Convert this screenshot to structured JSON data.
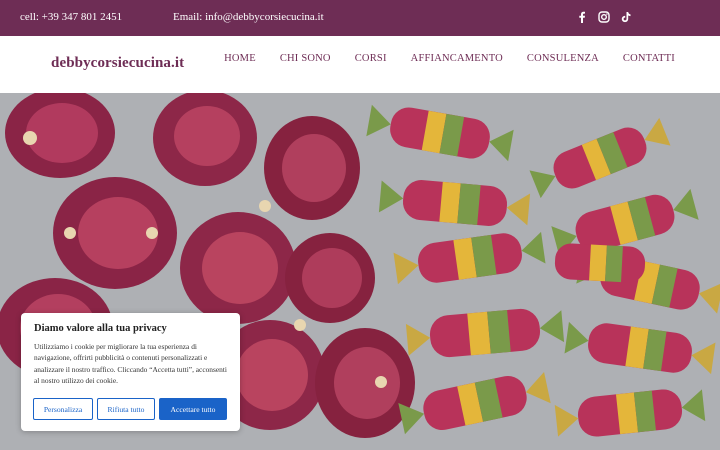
{
  "topbar": {
    "phone": "cell: +39 347 801 2451",
    "email": "Email: info@debbycorsiecucina.it",
    "social": [
      "facebook-icon",
      "instagram-icon",
      "tiktok-icon"
    ]
  },
  "header": {
    "logo": "debbycorsiecucina.it",
    "nav": [
      "HOME",
      "CHI SONO",
      "CORSI",
      "AFFIANCAMENTO",
      "CONSULENZA",
      "CONTATTI"
    ]
  },
  "cookie": {
    "title": "Diamo valore alla tua privacy",
    "text": "Utilizziamo i cookie per migliorare la tua esperienza di navigazione, offrirti pubblicità o contenuti personalizzati e analizzare il nostro traffico. Cliccando “Accetta tutti”, acconsenti al nostro utilizzo dei cookie.",
    "customize_label": "Personalizza",
    "reject_label": "Rifiuta tutto",
    "accept_label": "Accettare tutto"
  },
  "colors": {
    "brand": "#6e2d55",
    "accent_blue": "#1a63c8"
  }
}
